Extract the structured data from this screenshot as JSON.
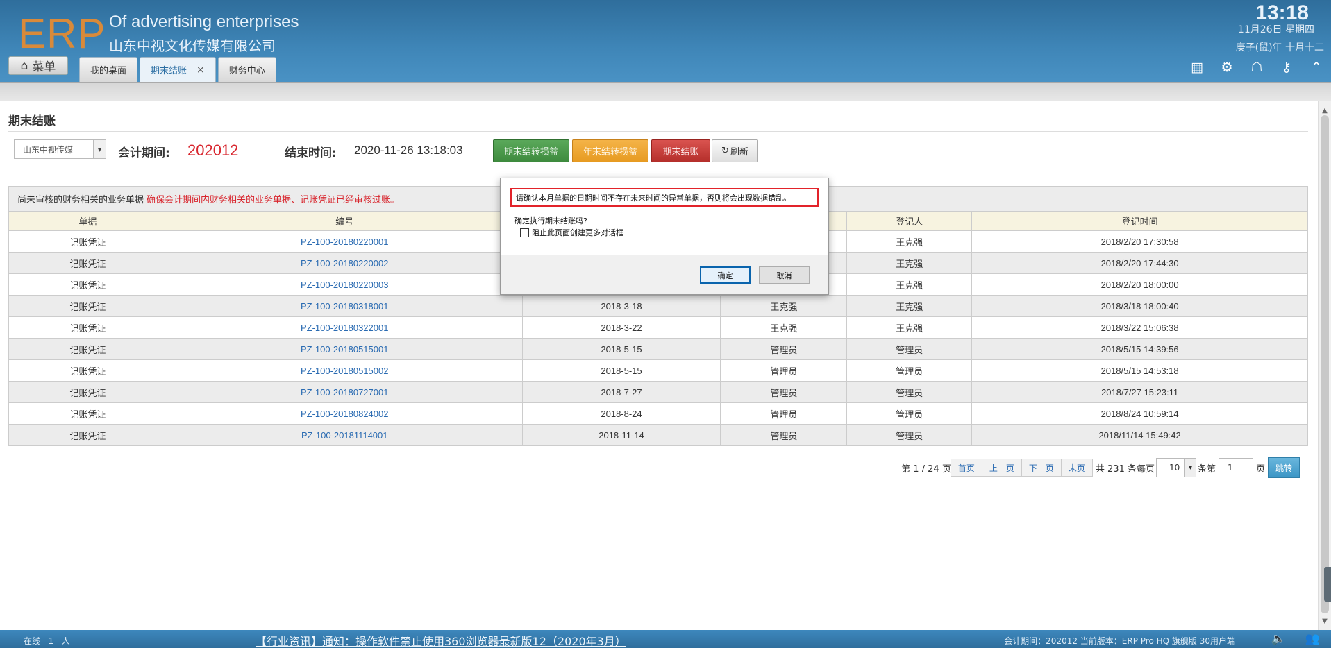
{
  "header": {
    "logo": "ERP",
    "company_en": "Of advertising enterprises",
    "company_cn": "山东中视文化传媒有限公司",
    "clock": "13:18",
    "date": "11月26日 星期四",
    "lunar": "庚子(鼠)年 十月十二",
    "menu_label": "菜单",
    "tabs": [
      {
        "label": "我的桌面"
      },
      {
        "label": "期末结账",
        "close": "×"
      },
      {
        "label": "财务中心"
      }
    ]
  },
  "page": {
    "title": "期末结账",
    "company_select": "山东中视传媒",
    "period_label": "会计期间:",
    "period_value": "202012",
    "end_label": "结束时间:",
    "end_value": "2020-11-26 13:18:03",
    "buttons": {
      "carry_profit": "期末结转损益",
      "year_end_profit": "年末结转损益",
      "close_period": "期末结账",
      "refresh": "刷新"
    },
    "notice": {
      "text": "尚未审核的财务相关的业务单据",
      "warning": "确保会计期间内财务相关的业务单据、记账凭证已经审核过账。"
    }
  },
  "table": {
    "columns": [
      "单据",
      "编号",
      "",
      "",
      "登记人",
      "登记时间"
    ],
    "rows": [
      [
        "记账凭证",
        "PZ-100-20180220001",
        "",
        "",
        "王克强",
        "2018/2/20 17:30:58"
      ],
      [
        "记账凭证",
        "PZ-100-20180220002",
        "",
        "",
        "王克强",
        "2018/2/20 17:44:30"
      ],
      [
        "记账凭证",
        "PZ-100-20180220003",
        "",
        "",
        "王克强",
        "2018/2/20 18:00:00"
      ],
      [
        "记账凭证",
        "PZ-100-20180318001",
        "2018-3-18",
        "王克强",
        "王克强",
        "2018/3/18 18:00:40"
      ],
      [
        "记账凭证",
        "PZ-100-20180322001",
        "2018-3-22",
        "王克强",
        "王克强",
        "2018/3/22 15:06:38"
      ],
      [
        "记账凭证",
        "PZ-100-20180515001",
        "2018-5-15",
        "管理员",
        "管理员",
        "2018/5/15 14:39:56"
      ],
      [
        "记账凭证",
        "PZ-100-20180515002",
        "2018-5-15",
        "管理员",
        "管理员",
        "2018/5/15 14:53:18"
      ],
      [
        "记账凭证",
        "PZ-100-20180727001",
        "2018-7-27",
        "管理员",
        "管理员",
        "2018/7/27 15:23:11"
      ],
      [
        "记账凭证",
        "PZ-100-20180824002",
        "2018-8-24",
        "管理员",
        "管理员",
        "2018/8/24 10:59:14"
      ],
      [
        "记账凭证",
        "PZ-100-20181114001",
        "2018-11-14",
        "管理员",
        "管理员",
        "2018/11/14 15:49:42"
      ]
    ]
  },
  "pager": {
    "page_info": "第 1 / 24 页",
    "first": "首页",
    "prev": "上一页",
    "next": "下一页",
    "last": "末页",
    "total_prefix": "共 231 条每页",
    "page_size": "10",
    "per_suffix": "条第",
    "page_input": "1",
    "page_suffix": "页",
    "go": "跳转"
  },
  "dialog": {
    "warning": "请确认本月单据的日期时间不存在未来时间的异常单据，否则将会出现数据错乱。",
    "question": "确定执行期末结账吗?",
    "checkbox_label": "阻止此页面创建更多对话框",
    "ok": "确定",
    "cancel": "取消"
  },
  "footer": {
    "online_label": "在线",
    "online_count": "1",
    "online_unit": "人",
    "news": "【行业资讯】通知：操作软件禁止使用360浏览器最新版12（2020年3月）",
    "version": "会计期间：202012 当前版本：ERP Pro HQ 旗舰版 30用户端"
  },
  "colors": {
    "header": "#3f86b8",
    "logo": "#d98a3a",
    "alert_red": "#d8262e",
    "link_blue": "#2a6bb2"
  }
}
